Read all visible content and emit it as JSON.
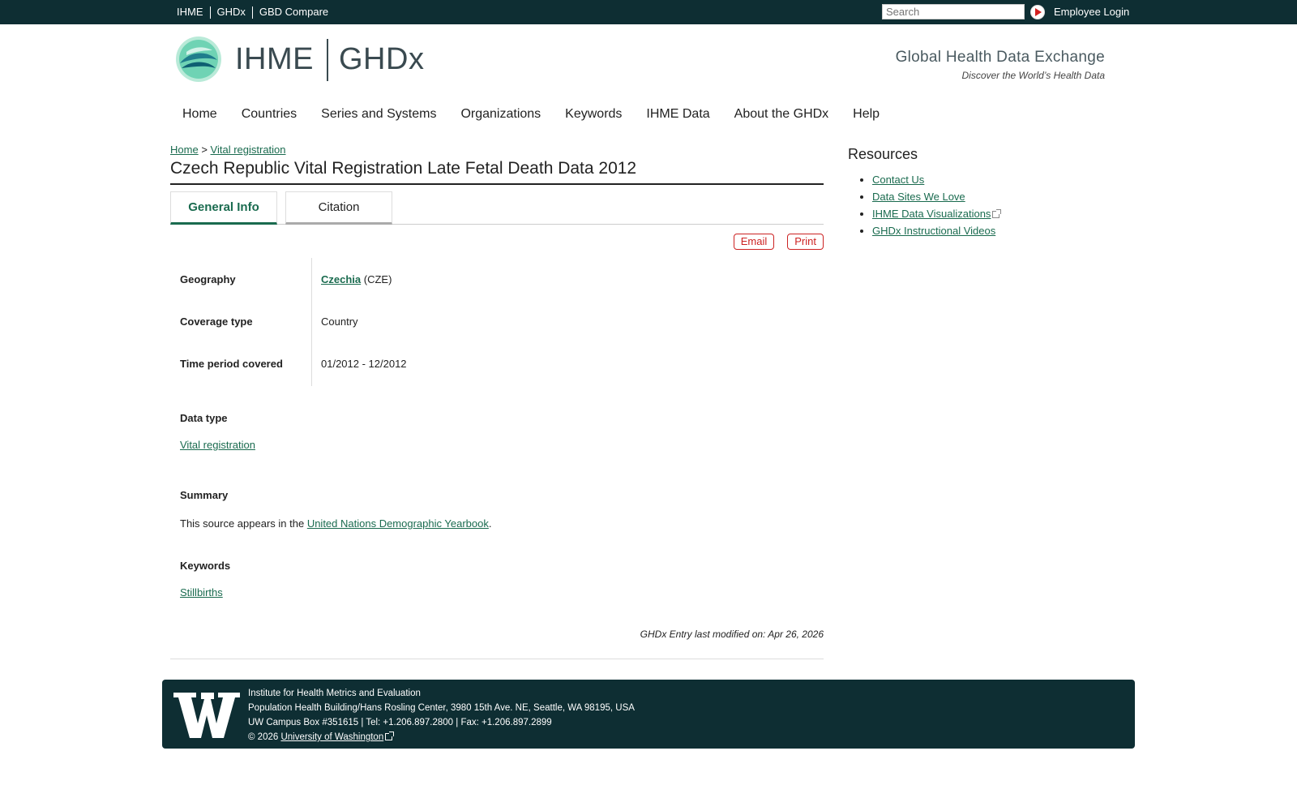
{
  "topnav": {
    "items": [
      "IHME",
      "GHDx",
      "GBD Compare"
    ],
    "search_placeholder": "Search",
    "login": "Employee Login"
  },
  "header": {
    "logo_left": "IHME",
    "logo_right": "GHDx",
    "tagline_title": "Global Health Data Exchange",
    "tagline_sub": "Discover the World’s Health Data"
  },
  "mainnav": {
    "items": [
      "Home",
      "Countries",
      "Series and Systems",
      "Organizations",
      "Keywords",
      "IHME Data",
      "About the GHDx",
      "Help"
    ]
  },
  "breadcrumb": {
    "home": "Home",
    "sep": ">",
    "current": "Vital registration"
  },
  "page": {
    "title": "Czech Republic Vital Registration Late Fetal Death Data 2012",
    "tabs": [
      "General Info",
      "Citation"
    ],
    "actions": {
      "email": "Email",
      "print": "Print"
    },
    "meta": {
      "geography_label": "Geography",
      "geography_link": "Czechia",
      "geography_code": " (CZE)",
      "coverage_label": "Coverage type",
      "coverage_value": "Country",
      "period_label": "Time period covered",
      "period_value": "01/2012 - 12/2012"
    },
    "data_type_label": "Data type",
    "data_type_value": "Vital registration",
    "summary_label": "Summary",
    "summary_prefix": "This source appears in the ",
    "summary_link": "United Nations Demographic Yearbook",
    "summary_suffix": ".",
    "keywords_label": "Keywords",
    "keywords_value": "Stillbirths",
    "modified": "GHDx Entry last modified on: Apr 26, 2026"
  },
  "sidebar": {
    "title": "Resources",
    "items": [
      "Contact Us",
      "Data Sites We Love",
      "IHME Data Visualizations",
      "GHDx Instructional Videos"
    ]
  },
  "footer": {
    "line1": "Institute for Health Metrics and Evaluation",
    "line2": "Population Health Building/Hans Rosling Center, 3980 15th Ave. NE, Seattle, WA 98195, USA",
    "line3": "UW Campus Box #351615 | Tel: +1.206.897.2800 | Fax: +1.206.897.2899",
    "copyright": "© 2026 ",
    "uw_link": "University of Washington"
  },
  "colors": {
    "topbar": "#0e2e33",
    "link": "#1a6b4f",
    "accent_red": "#cc2222"
  }
}
